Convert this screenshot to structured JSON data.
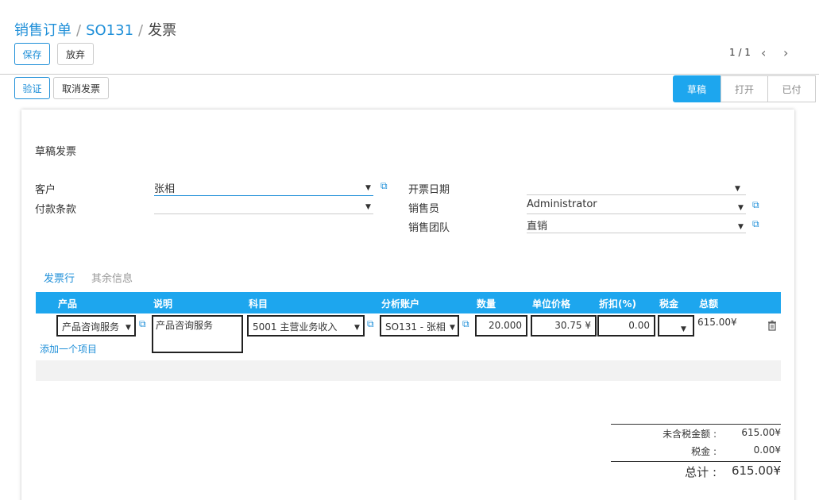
{
  "breadcrumb": {
    "item1": "销售订单",
    "item2": "SO131",
    "current": "发票",
    "sep": "/"
  },
  "buttons": {
    "save": "保存",
    "discard": "放弃",
    "validate": "验证",
    "cancel_invoice": "取消发票"
  },
  "pager": {
    "text": "1 / 1",
    "prev": "‹",
    "next": "›"
  },
  "statusbar": {
    "draft": "草稿",
    "open": "打开",
    "paid": "已付"
  },
  "form": {
    "title": "草稿发票",
    "customer_label": "客户",
    "customer_value": "张相",
    "payment_terms_label": "付款条款",
    "payment_terms_value": "",
    "invoice_date_label": "开票日期",
    "invoice_date_value": "",
    "salesperson_label": "销售员",
    "salesperson_value": "Administrator",
    "sales_team_label": "销售团队",
    "sales_team_value": "直销"
  },
  "tabs": {
    "lines": "发票行",
    "other": "其余信息"
  },
  "table": {
    "headers": {
      "product": "产品",
      "description": "说明",
      "account": "科目",
      "analytic": "分析账户",
      "quantity": "数量",
      "unit_price": "单位价格",
      "discount": "折扣(%)",
      "tax": "税金",
      "amount": "总额"
    },
    "row": {
      "product": "产品咨询服务",
      "description": "产品咨询服务",
      "account": "5001 主营业务收入",
      "analytic": "SO131 - 张相",
      "quantity": "20.000",
      "unit_price": "30.75 ¥",
      "discount": "0.00",
      "tax": "",
      "amount": "615.00¥"
    },
    "add_item": "添加一个项目"
  },
  "totals": {
    "untaxed_label": "未含税金额 :",
    "untaxed_value": "615.00¥",
    "tax_label": "税金 :",
    "tax_value": "0.00¥",
    "total_label": "总计 :",
    "total_value": "615.00¥"
  },
  "icons": {
    "external": "external-link-icon",
    "caret": "caret-down-icon",
    "trash": "trash-icon"
  },
  "colors": {
    "accent": "#1f8fd8",
    "header": "#1da6ee",
    "draft_bg": "#1da6ee"
  }
}
